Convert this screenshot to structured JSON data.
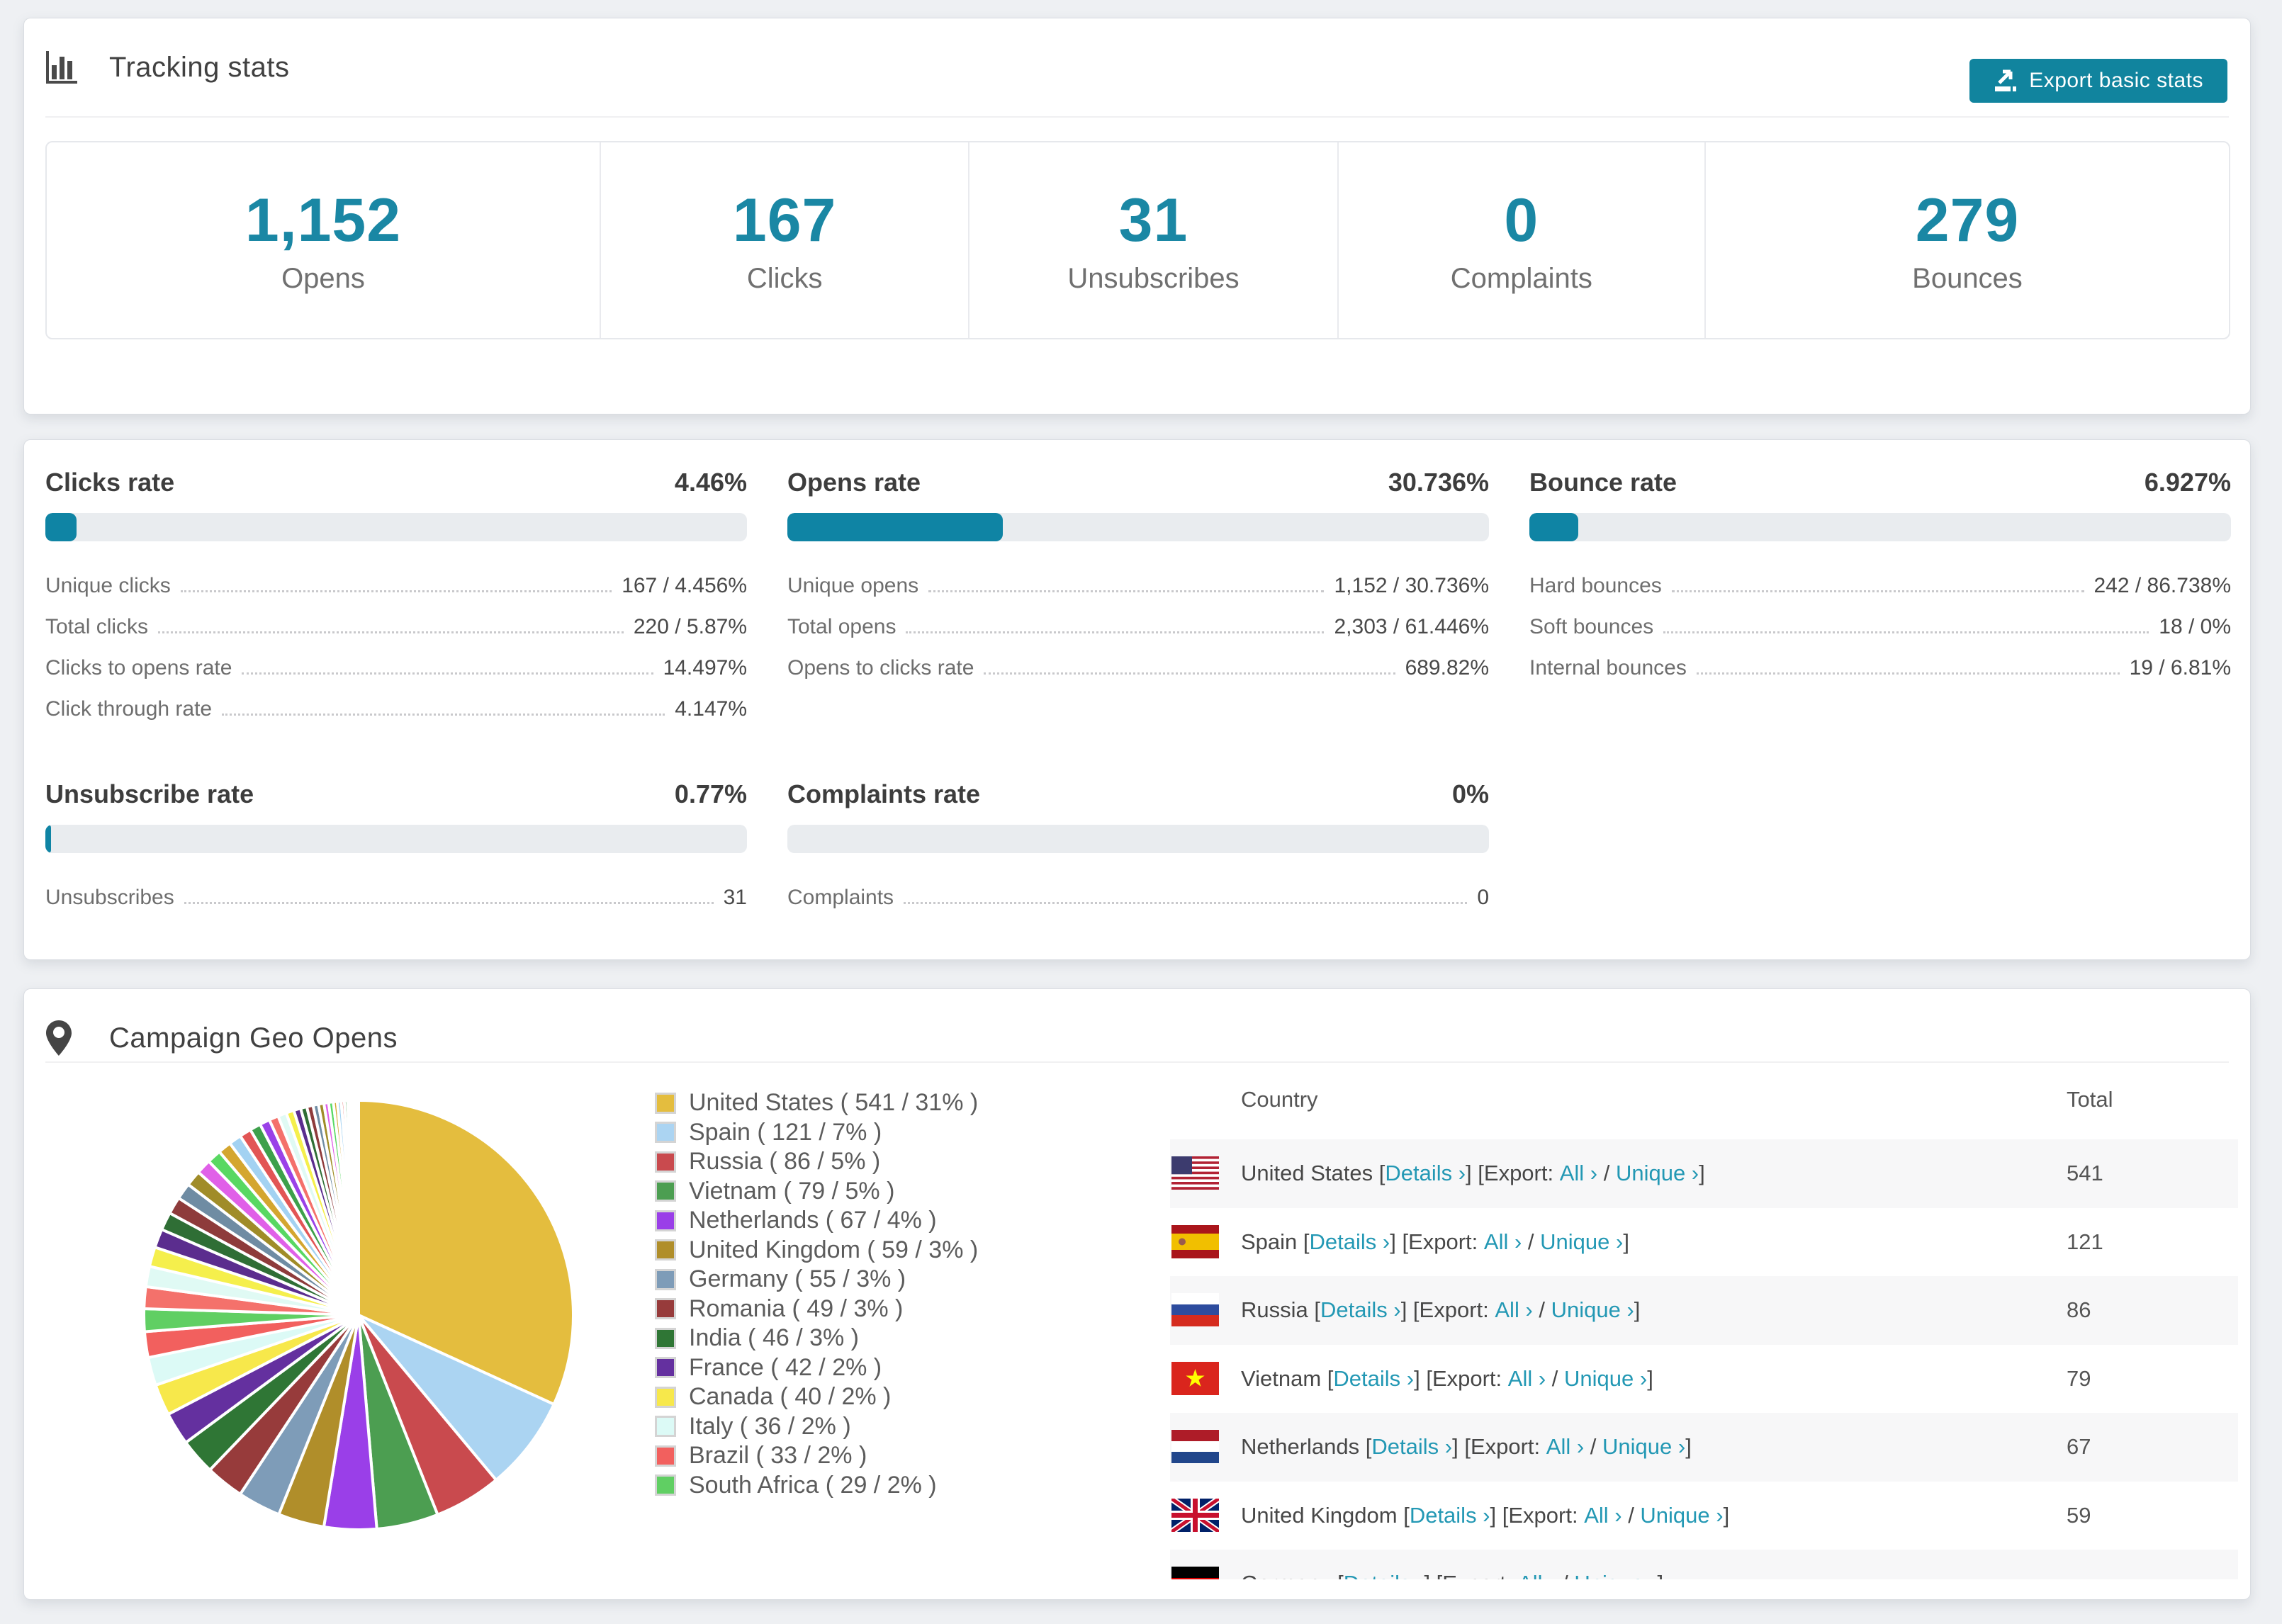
{
  "page_bg": "#eef0f3",
  "colors": {
    "accent_teal": "#1a87a4",
    "button_teal": "#11849e",
    "link_teal": "#2398b4",
    "bar_track": "#e9ecef",
    "bar_fill": "#0f84a4"
  },
  "tracking_card": {
    "title": "Tracking stats",
    "title_icon": "bar-chart-icon",
    "export_button_label": "Export basic stats",
    "stats": [
      {
        "value": "1,152",
        "label": "Opens"
      },
      {
        "value": "167",
        "label": "Clicks"
      },
      {
        "value": "31",
        "label": "Unsubscribes"
      },
      {
        "value": "0",
        "label": "Complaints"
      },
      {
        "value": "279",
        "label": "Bounces"
      }
    ]
  },
  "rates_card": {
    "blocks": [
      {
        "title": "Clicks rate",
        "value": "4.46%",
        "pct": 4.46,
        "rows": [
          {
            "label": "Unique clicks",
            "value": "167 / 4.456%"
          },
          {
            "label": "Total clicks",
            "value": "220 / 5.87%"
          },
          {
            "label": "Clicks to opens rate",
            "value": "14.497%"
          },
          {
            "label": "Click through rate",
            "value": "4.147%"
          }
        ]
      },
      {
        "title": "Opens rate",
        "value": "30.736%",
        "pct": 30.736,
        "rows": [
          {
            "label": "Unique opens",
            "value": "1,152 / 30.736%"
          },
          {
            "label": "Total opens",
            "value": "2,303 / 61.446%"
          },
          {
            "label": "Opens to clicks rate",
            "value": "689.82%"
          }
        ]
      },
      {
        "title": "Bounce rate",
        "value": "6.927%",
        "pct": 6.927,
        "rows": [
          {
            "label": "Hard bounces",
            "value": "242 / 86.738%"
          },
          {
            "label": "Soft bounces",
            "value": "18 / 0%"
          },
          {
            "label": "Internal bounces",
            "value": "19 / 6.81%"
          }
        ]
      },
      {
        "title": "Unsubscribe rate",
        "value": "0.77%",
        "pct": 0.77,
        "rows": [
          {
            "label": "Unsubscribes",
            "value": "31"
          }
        ]
      },
      {
        "title": "Complaints rate",
        "value": "0%",
        "pct": 0,
        "rows": [
          {
            "label": "Complaints",
            "value": "0"
          }
        ]
      }
    ]
  },
  "geo_card": {
    "title": "Campaign Geo Opens",
    "title_icon": "map-pin-icon",
    "chart_data": {
      "type": "pie",
      "title": "Campaign Geo Opens",
      "start_angle_deg": -90,
      "direction": "clockwise",
      "legend_position": "right",
      "series": [
        {
          "name": "United States",
          "value": 541,
          "pct": "31%",
          "color": "#e4bd3e"
        },
        {
          "name": "Spain",
          "value": 121,
          "pct": "7%",
          "color": "#abd4f2"
        },
        {
          "name": "Russia",
          "value": 86,
          "pct": "5%",
          "color": "#c94a4e"
        },
        {
          "name": "Vietnam",
          "value": 79,
          "pct": "5%",
          "color": "#4c9e51"
        },
        {
          "name": "Netherlands",
          "value": 67,
          "pct": "4%",
          "color": "#9a3fe8"
        },
        {
          "name": "United Kingdom",
          "value": 59,
          "pct": "3%",
          "color": "#b08e2a"
        },
        {
          "name": "Germany",
          "value": 55,
          "pct": "3%",
          "color": "#7e9cb8"
        },
        {
          "name": "Romania",
          "value": 49,
          "pct": "3%",
          "color": "#973b3b"
        },
        {
          "name": "India",
          "value": 46,
          "pct": "3%",
          "color": "#2f7635"
        },
        {
          "name": "France",
          "value": 42,
          "pct": "2%",
          "color": "#64309f"
        },
        {
          "name": "Canada",
          "value": 40,
          "pct": "2%",
          "color": "#f7e84b"
        },
        {
          "name": "Italy",
          "value": 36,
          "pct": "2%",
          "color": "#dcfaf6"
        },
        {
          "name": "Brazil",
          "value": 33,
          "pct": "2%",
          "color": "#f2605e"
        },
        {
          "name": "South Africa",
          "value": 29,
          "pct": "2%",
          "color": "#60cf63"
        }
      ],
      "unlabeled_tail_values": [
        28,
        26,
        25,
        24,
        23,
        22,
        21,
        20,
        19,
        18,
        17,
        16,
        15,
        14,
        13,
        12,
        11,
        10,
        9,
        8,
        8,
        7,
        7,
        6,
        6,
        5,
        5,
        4,
        4,
        3,
        3,
        2,
        2,
        2,
        1,
        1
      ],
      "tail_palette": [
        "#f4716b",
        "#e0faf4",
        "#f5ef4c",
        "#5b2d8e",
        "#2f6e35",
        "#8e3b3b",
        "#6f8ca3",
        "#a08c28",
        "#e060e8",
        "#58d862",
        "#d4a62f",
        "#a3d2f2",
        "#e25555",
        "#3da04b",
        "#9a41e8"
      ],
      "legend_label_format": "{name} ( {value} / {pct} )"
    },
    "table": {
      "headers": {
        "country": "Country",
        "total": "Total"
      },
      "link_labels": {
        "details": "Details ›",
        "export": "Export:",
        "all": "All ›",
        "unique": "Unique ›"
      },
      "rows": [
        {
          "flag": "us",
          "country": "United States",
          "total": "541"
        },
        {
          "flag": "es",
          "country": "Spain",
          "total": "121"
        },
        {
          "flag": "ru",
          "country": "Russia",
          "total": "86"
        },
        {
          "flag": "vn",
          "country": "Vietnam",
          "total": "79"
        },
        {
          "flag": "nl",
          "country": "Netherlands",
          "total": "67"
        },
        {
          "flag": "gb",
          "country": "United Kingdom",
          "total": "59"
        },
        {
          "flag": "de",
          "country": "Germany",
          "total": ""
        }
      ]
    }
  }
}
